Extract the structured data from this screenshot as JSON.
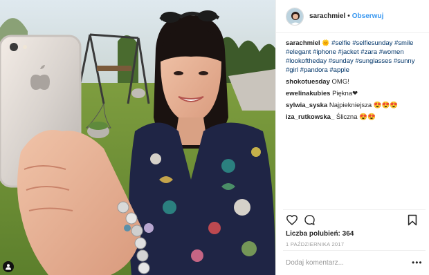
{
  "post": {
    "author": "sarachmiel",
    "separator": "•",
    "follow_label": "Obserwuj",
    "caption": {
      "user": "sarachmiel",
      "emoji": "🌞",
      "hashtags": [
        "#selfie",
        "#selfiesunday",
        "#smile",
        "#elegant",
        "#iphone",
        "#jacket",
        "#zara",
        "#women",
        "#lookoftheday",
        "#sunday",
        "#sunglasses",
        "#sunny",
        "#girl",
        "#pandora",
        "#apple"
      ]
    },
    "comments": [
      {
        "user": "shokotuesday",
        "text": "OMG!"
      },
      {
        "user": "ewelinakubies",
        "text": "Piękna❤"
      },
      {
        "user": "sylwia_syska",
        "text": "Najpiekniejsza 😍😍😍"
      },
      {
        "user": "iza_rutkowska_",
        "text": "Śliczna 😍😍"
      }
    ],
    "likes_text": "Liczba polubień: 364",
    "date": "1 PAŹDZIERNIKA 2017",
    "add_comment_placeholder": "Dodaj komentarz...",
    "more_label": "•••"
  },
  "icons": {
    "like": "heart-outline-icon",
    "comment": "speech-bubble-icon",
    "save": "bookmark-icon",
    "profile_tag": "user-tag-icon"
  },
  "colors": {
    "link": "#3897f0",
    "hashtag": "#003569",
    "meta": "#999999"
  }
}
